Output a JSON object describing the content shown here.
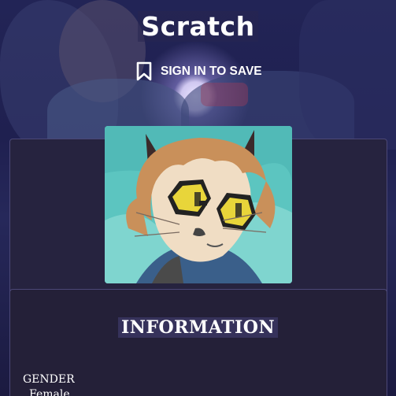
{
  "header": {
    "title": "Scratch",
    "sign_in_label": "SIGN IN TO SAVE"
  },
  "portrait": {
    "subject": "character portrait"
  },
  "information": {
    "heading": "INFORMATION",
    "fields": [
      {
        "label": "GENDER",
        "value": "Female"
      }
    ]
  },
  "colors": {
    "background": "#1a1838",
    "panel": "#26233f",
    "panel_border": "#4b4877",
    "text": "#ffffff",
    "portrait_sky": "#5cc5c0",
    "goggle_lens": "#e8d53a"
  },
  "icons": {
    "sign_in": "bookmark-icon"
  }
}
